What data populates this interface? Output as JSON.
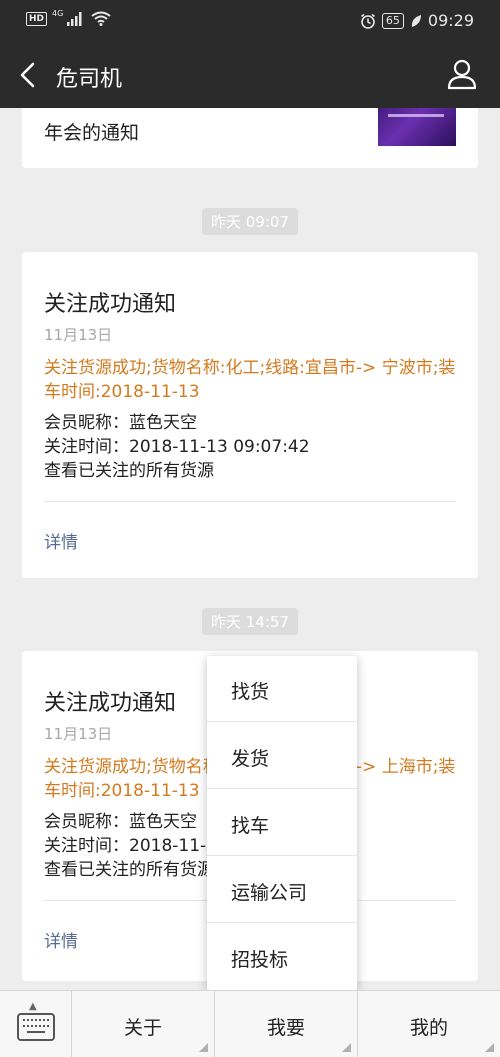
{
  "status_bar": {
    "hd": "HD",
    "network": "4G",
    "battery": "65",
    "time": "09:29"
  },
  "nav": {
    "title": "危司机"
  },
  "messages": {
    "partial_card": {
      "text": "年会的通知"
    },
    "timestamp_1": "昨天 09:07",
    "card_1": {
      "title": "关注成功通知",
      "date": "11月13日",
      "highlight": "关注货源成功;货物名称:化工;线路:宜昌市-> 宁波市;装车时间:2018-11-13",
      "member": "会员昵称：蓝色天空",
      "follow_time": "关注时间：2018-11-13 09:07:42",
      "view_all": "查看已关注的所有货源",
      "detail": "详情"
    },
    "timestamp_2": "昨天 14:57",
    "card_2": {
      "title": "关注成功通知",
      "date": "11月13日",
      "highlight": "关注货源成功;货物名称:化工;线路:大连市-> 上海市;装车时间:2018-11-13",
      "member": "会员昵称：蓝色天空",
      "follow_time": "关注时间：2018-11-13 14:57:",
      "view_all": "查看已关注的所有货源",
      "detail": "详情"
    }
  },
  "popup_menu": {
    "items": [
      "找货",
      "发货",
      "找车",
      "运输公司",
      "招投标"
    ]
  },
  "bottom_menu": {
    "items": [
      "关于",
      "我要",
      "我的"
    ]
  }
}
